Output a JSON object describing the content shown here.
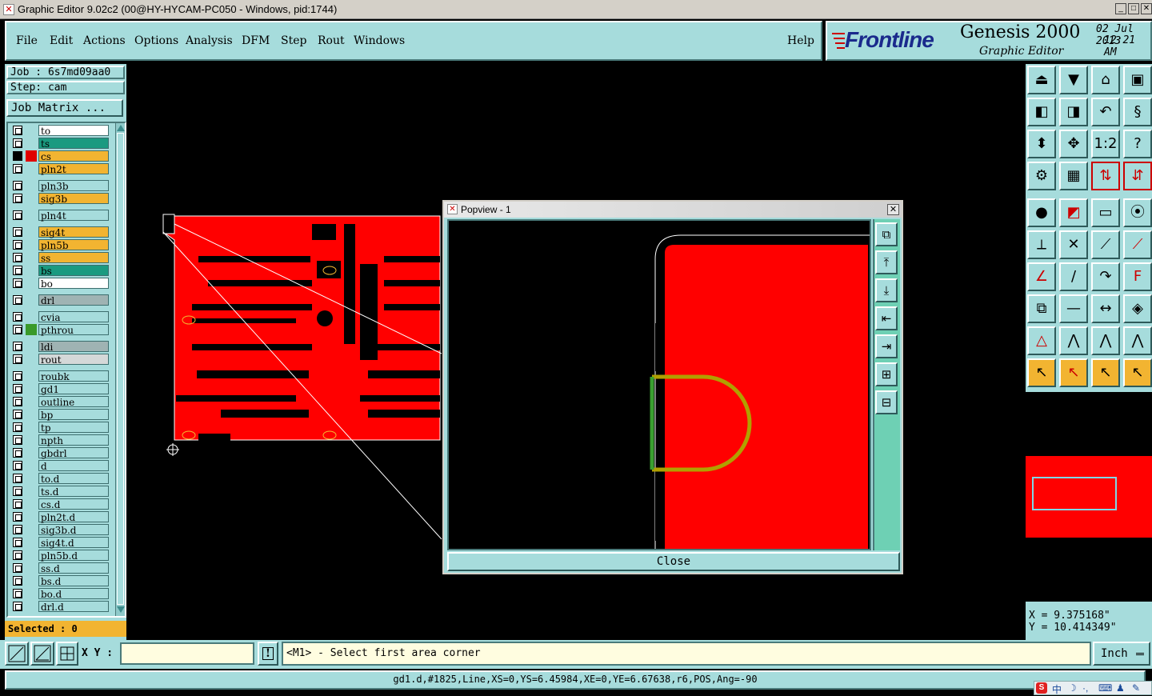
{
  "window": {
    "title": "Graphic Editor 9.02c2 (00@HY-HYCAM-PC050 - Windows, pid:1744)"
  },
  "menu": {
    "file": "File",
    "edit": "Edit",
    "actions": "Actions",
    "options": "Options",
    "analysis": "Analysis",
    "dfm": "DFM",
    "step": "Step",
    "rout": "Rout",
    "windows": "Windows",
    "help": "Help"
  },
  "brand": {
    "logo": "Frontline",
    "product": "Genesis 2000",
    "subtitle": "Graphic Editor",
    "date": "02 Jul 2013",
    "time": "12:21 AM"
  },
  "job": {
    "job_label": "Job : 6s7md09aa0",
    "step_label": "Step: cam",
    "matrix_button": "Job Matrix ..."
  },
  "layers": [
    {
      "name": "to",
      "color": "#ffffff",
      "ind": ""
    },
    {
      "name": "ts",
      "color": "#1a9a80",
      "ind": ""
    },
    {
      "name": "cs",
      "color": "#f2b431",
      "ind": "#e00000",
      "active": true
    },
    {
      "name": "pln2t",
      "color": "#f2b431",
      "ind": ""
    },
    {
      "name": "pln3b",
      "color": "#a6dcdc",
      "ind": ""
    },
    {
      "name": "sig3b",
      "color": "#f2b431",
      "ind": ""
    },
    {
      "name": "pln4t",
      "color": "#a6dcdc",
      "ind": ""
    },
    {
      "name": "sig4t",
      "color": "#f2b431",
      "ind": ""
    },
    {
      "name": "pln5b",
      "color": "#f2b431",
      "ind": ""
    },
    {
      "name": "ss",
      "color": "#f2b431",
      "ind": ""
    },
    {
      "name": "bs",
      "color": "#1a9a80",
      "ind": ""
    },
    {
      "name": "bo",
      "color": "#ffffff",
      "ind": ""
    },
    {
      "name": "drl",
      "color": "#9fb3b3",
      "ind": ""
    },
    {
      "name": "cvia",
      "color": "#a6dcdc",
      "ind": ""
    },
    {
      "name": "pthrou",
      "color": "#a6dcdc",
      "ind": "#3a9a2a"
    },
    {
      "name": "ldi",
      "color": "#9fb3b3",
      "ind": ""
    },
    {
      "name": "rout",
      "color": "#d4d8d8",
      "ind": ""
    },
    {
      "name": "roubk",
      "color": "#a6dcdc",
      "ind": ""
    },
    {
      "name": "gd1",
      "color": "#a6dcdc",
      "ind": ""
    },
    {
      "name": "outline",
      "color": "#a6dcdc",
      "ind": ""
    },
    {
      "name": "bp",
      "color": "#a6dcdc",
      "ind": ""
    },
    {
      "name": "tp",
      "color": "#a6dcdc",
      "ind": ""
    },
    {
      "name": "npth",
      "color": "#a6dcdc",
      "ind": ""
    },
    {
      "name": "gbdrl",
      "color": "#a6dcdc",
      "ind": ""
    },
    {
      "name": "d",
      "color": "#a6dcdc",
      "ind": ""
    },
    {
      "name": "to.d",
      "color": "#a6dcdc",
      "ind": ""
    },
    {
      "name": "ts.d",
      "color": "#a6dcdc",
      "ind": ""
    },
    {
      "name": "cs.d",
      "color": "#a6dcdc",
      "ind": ""
    },
    {
      "name": "pln2t.d",
      "color": "#a6dcdc",
      "ind": ""
    },
    {
      "name": "sig3b.d",
      "color": "#a6dcdc",
      "ind": ""
    },
    {
      "name": "sig4t.d",
      "color": "#a6dcdc",
      "ind": ""
    },
    {
      "name": "pln5b.d",
      "color": "#a6dcdc",
      "ind": ""
    },
    {
      "name": "ss.d",
      "color": "#a6dcdc",
      "ind": ""
    },
    {
      "name": "bs.d",
      "color": "#a6dcdc",
      "ind": ""
    },
    {
      "name": "bo.d",
      "color": "#a6dcdc",
      "ind": ""
    },
    {
      "name": "drl.d",
      "color": "#a6dcdc",
      "ind": ""
    }
  ],
  "selected_label": "Selected : 0",
  "popview": {
    "title": "Popview - 1",
    "close_label": "Close"
  },
  "coords": {
    "x": "X = 9.375168\"",
    "y": "Y = 10.414349\""
  },
  "status": {
    "xy_label": "X Y :",
    "xy_value": "",
    "prompt": "<M1> - Select first area corner",
    "units": "Inch"
  },
  "feature_info": "gd1.d,#1825,Line,XS=0,YS=6.45984,XE=0,YE=6.67638,r6,POS,Ang=-90",
  "tray": {
    "ime_label": "中"
  }
}
